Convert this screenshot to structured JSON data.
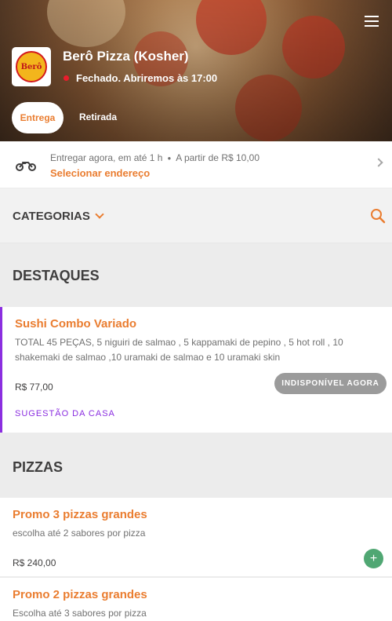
{
  "header": {
    "menu_icon": "hamburger-menu-icon",
    "store_name": "Berô Pizza (Kosher)",
    "logo_text": "Berô",
    "status_text": "Fechado. Abriremos às 17:00",
    "status_color": "#ea1d2c",
    "tabs": [
      {
        "label": "Entrega",
        "active": true
      },
      {
        "label": "Retirada",
        "active": false
      }
    ]
  },
  "delivery": {
    "icon": "motorcycle-icon",
    "when": "Entregar agora,",
    "eta": "em até 1 h",
    "min_order": "A partir de R$ 10,00",
    "address_prompt": "Selecionar endereço"
  },
  "categories": {
    "label": "CATEGORIAS",
    "search_icon": "search-icon"
  },
  "sections": {
    "featured": {
      "title": "DESTAQUES",
      "items": [
        {
          "name": "Sushi Combo Variado",
          "description": "TOTAL 45 PEÇAS, 5 niguiri de salmao , 5 kappamaki de pepino , 5 hot roll , 10 shakemaki de salmao ,10 uramaki de salmao e 10 uramaki skin",
          "price": "R$ 77,00",
          "badge": "INDISPONÍVEL AGORA",
          "tag": "SUGESTÃO DA CASA"
        }
      ]
    },
    "pizzas": {
      "title": "PIZZAS",
      "items": [
        {
          "name": "Promo 3 pizzas grandes",
          "description": "escolha até 2 sabores por pizza",
          "price": "R$ 240,00",
          "add_label": "+"
        },
        {
          "name": "Promo 2 pizzas grandes",
          "description": "Escolha até 3 sabores por pizza"
        }
      ]
    }
  },
  "colors": {
    "accent": "#ea7d30",
    "highlight": "#8b2ee0",
    "add_button": "#50a773",
    "unavailable": "#9b9b9b"
  }
}
